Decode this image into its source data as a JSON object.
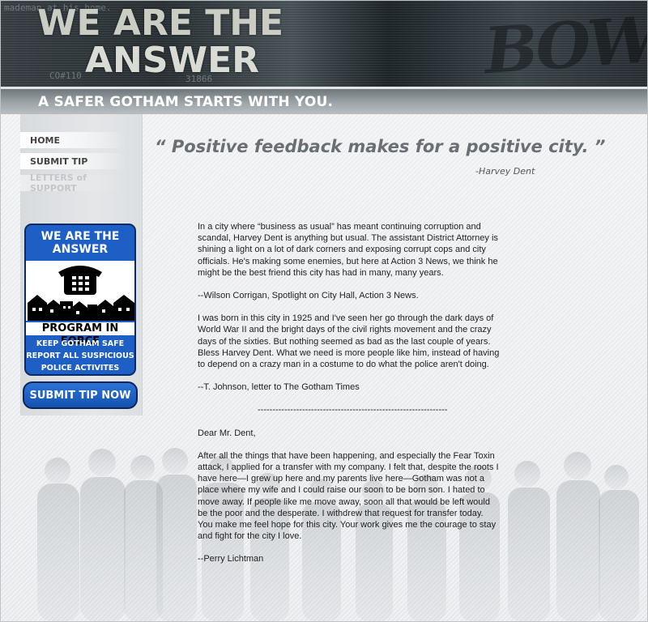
{
  "header": {
    "title_line1": "WE ARE THE",
    "title_line2": "ANSWER",
    "scrawl_1": "mademan at his home.",
    "scrawl_2": "CO#110",
    "scrawl_3": "31866",
    "tagline": "A SAFER GOTHAM STARTS WITH YOU."
  },
  "sidebar": {
    "nav": [
      {
        "label": "HOME"
      },
      {
        "label": "SUBMIT TIP"
      },
      {
        "label": "LETTERS of SUPPORT"
      }
    ],
    "badge": {
      "title_line1": "WE ARE THE",
      "title_line2": "ANSWER",
      "program": "PROGRAM IN FORCE",
      "line1": "KEEP GOTHAM SAFE",
      "line2": "REPORT ALL SUSPICIOUS",
      "line3": "POLICE ACTIVITES"
    },
    "submit_button": "SUBMIT TIP NOW"
  },
  "main": {
    "quote": "“ Positive feedback makes for a positive city. ”",
    "quote_attribution": "-Harvey Dent",
    "paragraphs": [
      "In a city where “business as usual” has meant continuing corruption and scandal, Harvey Dent is anything but usual. The assistant District Attorney is shining a light on a lot of dark corners and exposing corrupt cops and city officials. He's making some enemies, but here at Action 3 News, we think he might be the best friend this city has had in many, many years.",
      "--Wilson Corrigan, Spotlight on City Hall, Action 3 News.",
      "I was born in this city in 1925 and I've seen her go through the dark days of World War II and the bright days of the civil rights movement and the crazy days of the sixties. But nothing seemed as bad as the last couple of years. Bless Harvey Dent. What we need is more people like him, instead of having to depend on a crazy man in a costume to do what the police aren't doing.",
      "--T. Johnson, letter to The Gotham Times",
      "----------------------------------------------------------------",
      "Dear Mr. Dent,",
      "After all the things that have been happening, and especially the Fear Toxin attack, I applied for a transfer with my company. I felt that, despite the roots I have here—I grew up here and my parents live here—Gotham was not a place where my wife and I could raise our soon to be born son. I hated to move away. If people like me move away, soon all that would be left would be the poor and the desperate. I withdrew that request for transfer today. You make me feel hope for this city. Your work gives me the courage to stay and fight for the city I love.",
      "--Perry Lichtman"
    ]
  }
}
